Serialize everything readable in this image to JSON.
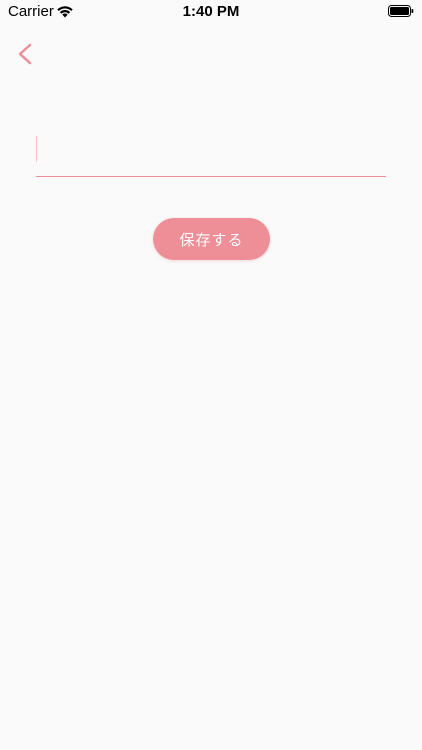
{
  "status_bar": {
    "carrier": "Carrier",
    "time": "1:40 PM",
    "wifi_icon": "wifi-icon",
    "battery_icon": "battery-full-icon"
  },
  "nav": {
    "back_icon": "chevron-left-icon"
  },
  "form": {
    "input_value": "",
    "input_placeholder": ""
  },
  "actions": {
    "save_label": "保存する"
  },
  "colors": {
    "accent": "#ee8e96",
    "background": "#fafafa",
    "text_on_accent": "#ffffff"
  }
}
